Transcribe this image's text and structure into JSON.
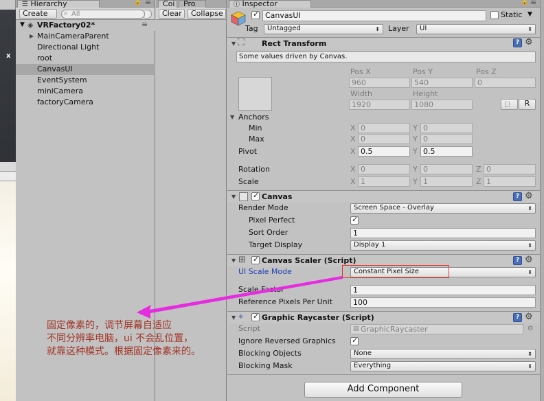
{
  "hierarchy": {
    "tab_title": "Hierarchy",
    "create_label": "Create",
    "search_placeholder": "All",
    "scene_name": "VRFactory02*",
    "items": [
      {
        "label": "MainCameraParent",
        "has_children": true,
        "selected": false
      },
      {
        "label": "Directional Light",
        "has_children": false,
        "selected": false
      },
      {
        "label": "root",
        "has_children": false,
        "selected": false
      },
      {
        "label": "CanvasUI",
        "has_children": false,
        "selected": true
      },
      {
        "label": "EventSystem",
        "has_children": false,
        "selected": false
      },
      {
        "label": "miniCamera",
        "has_children": false,
        "selected": false
      },
      {
        "label": "factoryCamera",
        "has_children": false,
        "selected": false
      }
    ]
  },
  "console": {
    "tab_console": "Coi",
    "tab_project": "Pro",
    "clear_label": "Clear",
    "collapse_label": "Collapse"
  },
  "inspector": {
    "tab_title": "Inspector",
    "object_name": "CanvasUI",
    "static_label": "Static",
    "tag_label": "Tag",
    "tag_value": "Untagged",
    "layer_label": "Layer",
    "layer_value": "UI",
    "rect_transform": {
      "title": "Rect Transform",
      "driven_note": "Some values driven by Canvas.",
      "pos_x_label": "Pos X",
      "pos_x": "960",
      "pos_y_label": "Pos Y",
      "pos_y": "540",
      "pos_z_label": "Pos Z",
      "pos_z": "0",
      "width_label": "Width",
      "width": "1920",
      "height_label": "Height",
      "height": "1080",
      "r_button": "R",
      "anchors_label": "Anchors",
      "min_label": "Min",
      "min_x": "0",
      "min_y": "0",
      "max_label": "Max",
      "max_x": "0",
      "max_y": "0",
      "pivot_label": "Pivot",
      "pivot_x": "0.5",
      "pivot_y": "0.5",
      "rotation_label": "Rotation",
      "rot_x": "0",
      "rot_y": "0",
      "rot_z": "0",
      "scale_label": "Scale",
      "scale_x": "1",
      "scale_y": "1",
      "scale_z": "1",
      "axis_x": "X",
      "axis_y": "Y",
      "axis_z": "Z"
    },
    "canvas": {
      "title": "Canvas",
      "render_mode_label": "Render Mode",
      "render_mode": "Screen Space - Overlay",
      "pixel_perfect_label": "Pixel Perfect",
      "pixel_perfect": true,
      "sort_order_label": "Sort Order",
      "sort_order": "1",
      "target_display_label": "Target Display",
      "target_display": "Display 1"
    },
    "canvas_scaler": {
      "title": "Canvas Scaler (Script)",
      "ui_scale_mode_label": "UI Scale Mode",
      "ui_scale_mode": "Constant Pixel Size",
      "scale_factor_label": "Scale Factor",
      "scale_factor": "1",
      "ref_ppu_label": "Reference Pixels Per Unit",
      "ref_ppu": "100"
    },
    "graphic_raycaster": {
      "title": "Graphic Raycaster (Script)",
      "script_label": "Script",
      "script_value": "GraphicRaycaster",
      "ignore_reversed_label": "Ignore Reversed Graphics",
      "ignore_reversed": true,
      "blocking_objects_label": "Blocking Objects",
      "blocking_objects": "None",
      "blocking_mask_label": "Blocking Mask",
      "blocking_mask": "Everything"
    },
    "add_component": "Add Component"
  },
  "annotation": {
    "line1": "固定像素的，调节屏幕自适应",
    "line2": "不同分辨率电脑，ui 不会乱位置，",
    "line3": "就靠这种模式。根据固定像素来的。",
    "highlight_color": "#e8322a",
    "arrow_color": "#e52ce0"
  },
  "colors": {
    "selection": "#a7a7a7",
    "link_blue": "#1f3fb5",
    "annotation_text": "#a33426"
  }
}
